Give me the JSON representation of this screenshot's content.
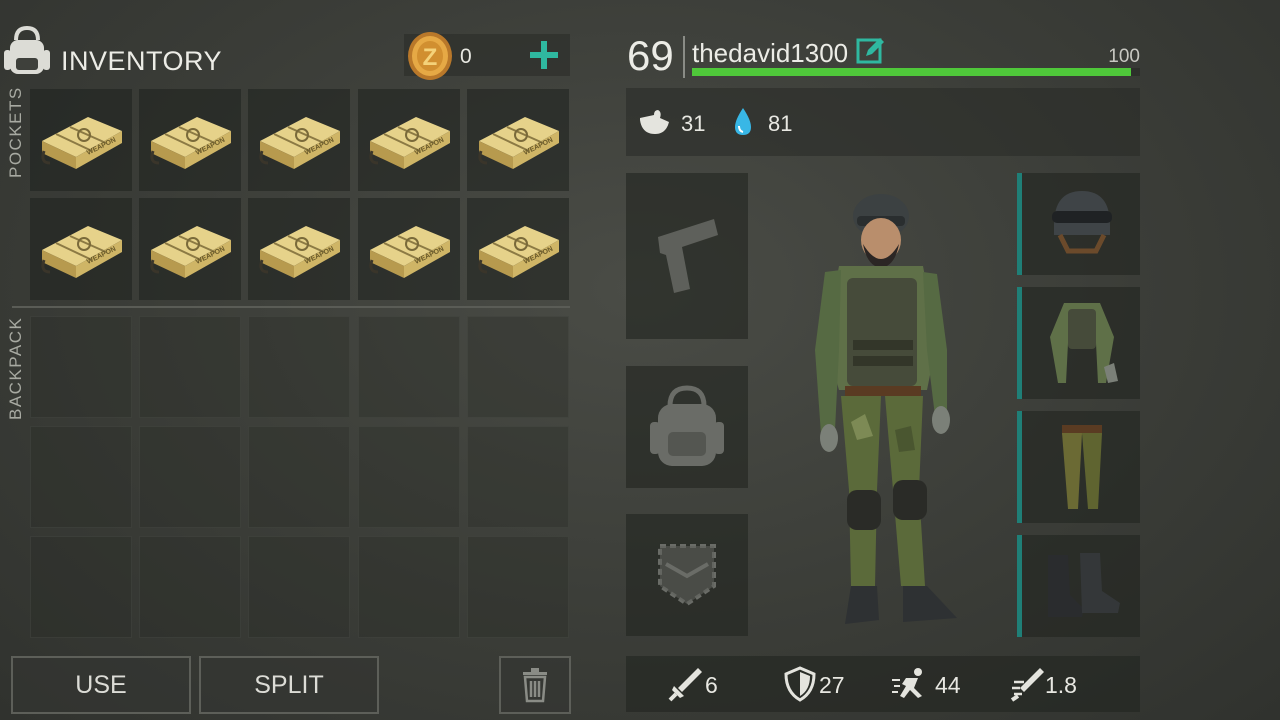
{
  "header": {
    "title": "INVENTORY",
    "coins": "0"
  },
  "sections": {
    "pockets": "POCKETS",
    "backpack": "BACKPACK"
  },
  "pocket_items": [
    {
      "name": "weapon-crate",
      "label": "WEAPON"
    },
    {
      "name": "weapon-crate",
      "label": "WEAPON"
    },
    {
      "name": "weapon-crate",
      "label": "WEAPON"
    },
    {
      "name": "weapon-crate",
      "label": "WEAPON"
    },
    {
      "name": "weapon-crate",
      "label": "WEAPON"
    },
    {
      "name": "weapon-crate",
      "label": "WEAPON"
    },
    {
      "name": "weapon-crate",
      "label": "WEAPON"
    },
    {
      "name": "weapon-crate",
      "label": "WEAPON"
    },
    {
      "name": "weapon-crate",
      "label": "WEAPON"
    },
    {
      "name": "weapon-crate",
      "label": "WEAPON"
    }
  ],
  "backpack_slots": 15,
  "actions": {
    "use": "USE",
    "split": "SPLIT"
  },
  "player": {
    "level": "69",
    "username": "thedavid1300",
    "xp_max": "100",
    "xp_fraction": 0.98,
    "food": "31",
    "water": "81"
  },
  "stats": {
    "damage": "6",
    "armor": "27",
    "speed": "44",
    "weight": "1.8"
  },
  "equipment_slots": [
    "weapon",
    "backpack",
    "pocket",
    "helmet",
    "jacket",
    "pants",
    "boots"
  ],
  "colors": {
    "accent_green": "#4fc83a",
    "teal": "#2fb8a0",
    "slot_bar": "#1f7f77"
  }
}
